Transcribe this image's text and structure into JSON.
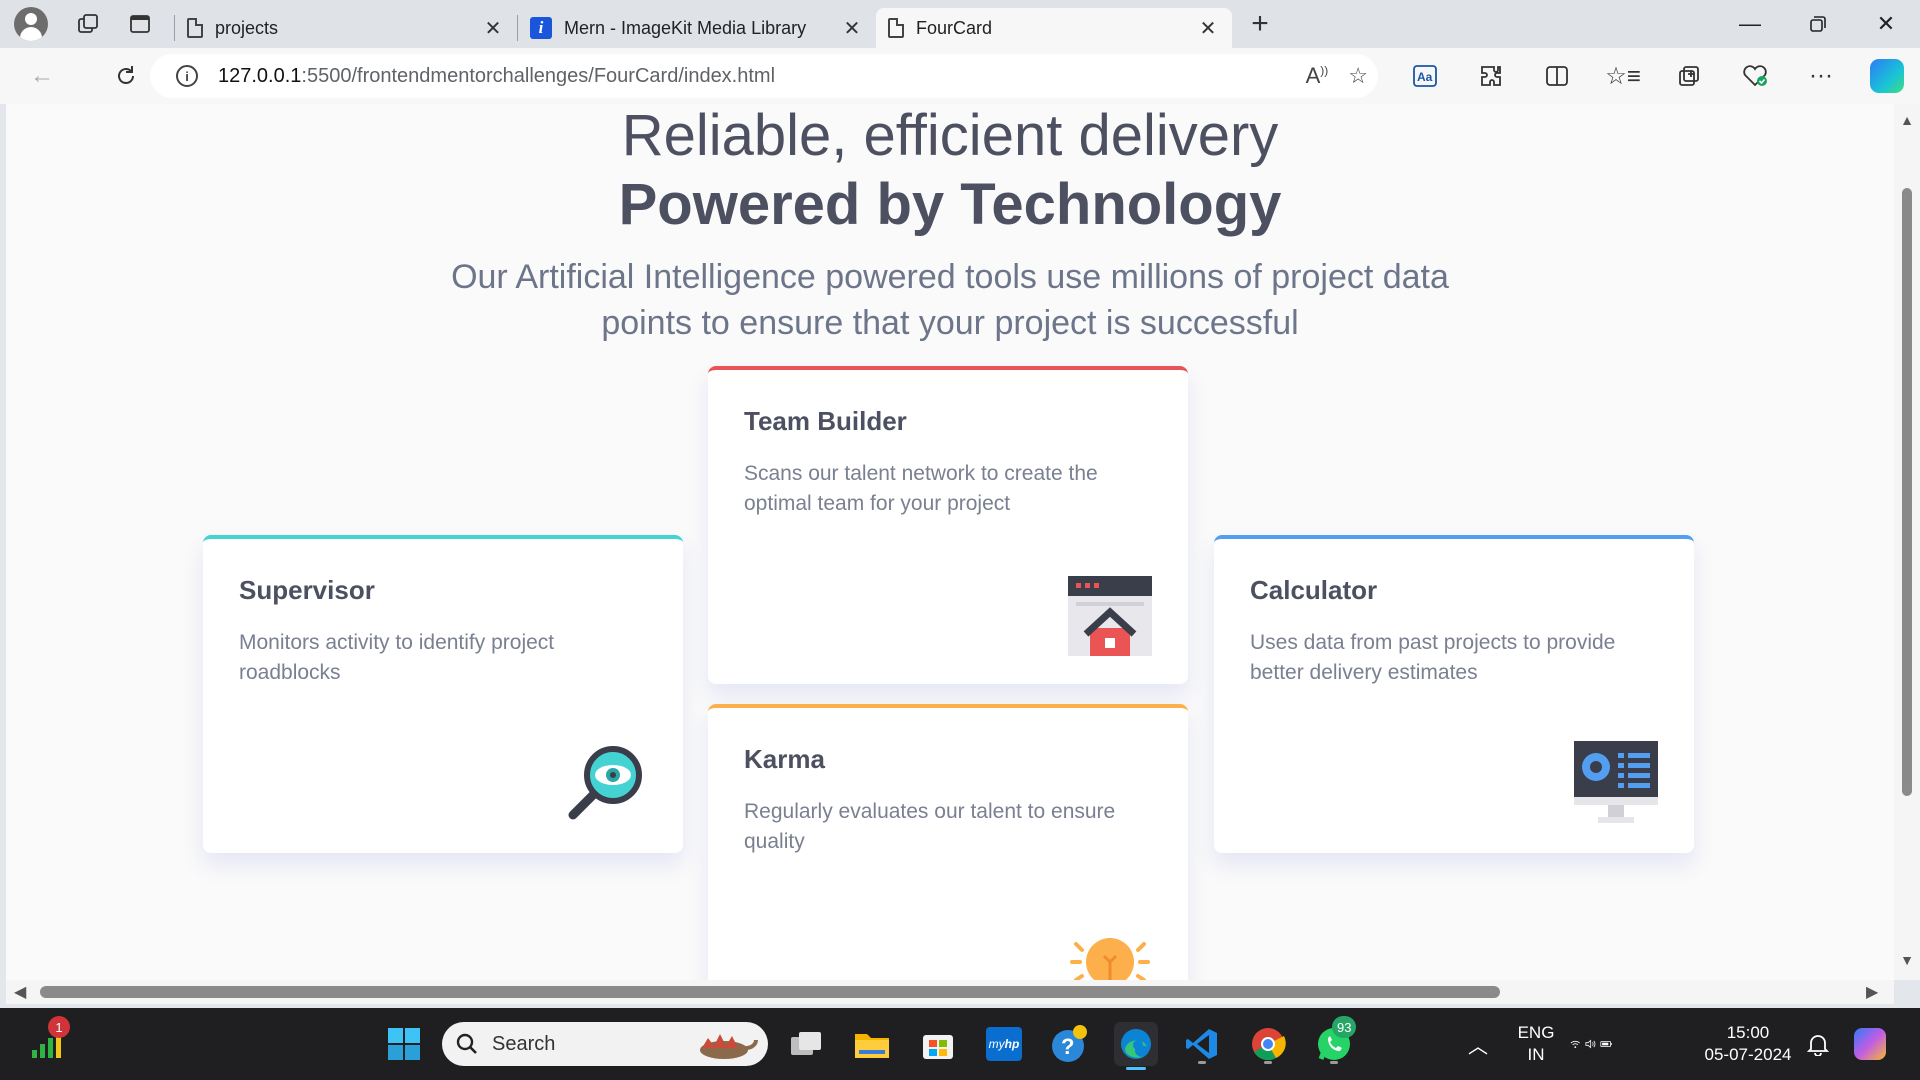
{
  "browser": {
    "tabs": [
      {
        "title": "projects"
      },
      {
        "title": "Mern - ImageKit Media Library"
      },
      {
        "title": "FourCard"
      }
    ],
    "url_host": "127.0.0.1",
    "url_path": ":5500/frontendmentorchallenges/FourCard/index.html"
  },
  "page": {
    "heading_light": "Reliable, efficient delivery",
    "heading_bold": "Powered by Technology",
    "subtitle": "Our Artificial Intelligence powered tools use millions of project data points to ensure that your project is successful",
    "cards": [
      {
        "title": "Supervisor",
        "text": "Monitors activity to identify project roadblocks",
        "accent": "#44d3d2",
        "icon": "magnifier-eye-icon"
      },
      {
        "title": "Team Builder",
        "text": "Scans our talent network to create the optimal team for your project",
        "accent": "#ea5454",
        "icon": "team-builder-icon"
      },
      {
        "title": "Karma",
        "text": "Regularly evaluates our talent to ensure quality",
        "accent": "#fcaf4a",
        "icon": "lightbulb-icon"
      },
      {
        "title": "Calculator",
        "text": "Uses data from past projects to provide better delivery estimates",
        "accent": "#549ef2",
        "icon": "monitor-calculator-icon"
      }
    ]
  },
  "taskbar": {
    "search_placeholder": "Search",
    "lang_top": "ENG",
    "lang_bottom": "IN",
    "time": "15:00",
    "date": "05-07-2024",
    "notif_badge_stocks": "1",
    "whatsapp_badge": "93"
  }
}
